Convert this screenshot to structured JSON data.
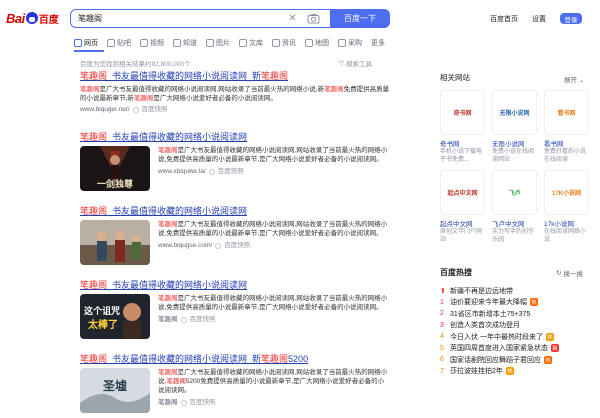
{
  "header": {
    "logo_text_a": "Bai",
    "logo_text_b": "百度",
    "query": "笔趣阁",
    "search_button": "百度一下",
    "nav": [
      "百度首页",
      "设置"
    ],
    "login": "登录"
  },
  "tabs": [
    "网页",
    "贴吧",
    "视频",
    "知道",
    "图片",
    "文库",
    "资讯",
    "地图",
    "采购",
    "更多"
  ],
  "result_count": "百度为您找到相关结果约92,800,000个",
  "search_tools": "搜索工具",
  "results": [
    {
      "title_parts": [
        {
          "t": "笔趣阁",
          "h": true
        },
        {
          "t": "_书友最值得收藏的网络小说阅读网_新",
          "h": false
        },
        {
          "t": "笔趣阁",
          "h": true
        }
      ],
      "desc_parts": [
        {
          "t": "笔趣阁",
          "h": true
        },
        {
          "t": "是广大书友最值得收藏的网络小说阅读网,网站收录了当前最火热的网络小说,新",
          "h": false
        },
        {
          "t": "笔趣阁",
          "h": true
        },
        {
          "t": "免费提供高质量的小说最新章节,新",
          "h": false
        },
        {
          "t": "笔趣阁",
          "h": true
        },
        {
          "t": "是广大网络小说爱好者必备的小说阅读网。",
          "h": false
        }
      ],
      "url": "www.biquger.net/",
      "snapshot": "百度快照"
    },
    {
      "title_parts": [
        {
          "t": "笔趣阁",
          "h": true
        },
        {
          "t": "_书友最值得收藏的网络小说阅读网",
          "h": false
        }
      ],
      "desc_parts": [
        {
          "t": "笔趣阁",
          "h": true
        },
        {
          "t": "是广大书友最值得收藏的网络小说阅读网,网站收录了当前最火热的网络小说,免费提供高质量的小说最新章节,是广大网络小说爱好者必备的小说阅读网。",
          "h": false
        }
      ],
      "url": "www.xbiquwx.la/",
      "snapshot": "百度快照",
      "thumb": "一剑独尊"
    },
    {
      "title_parts": [
        {
          "t": "笔趣阁",
          "h": true
        },
        {
          "t": "_书友最值得收藏的网络小说阅读网",
          "h": false
        }
      ],
      "desc_parts": [
        {
          "t": "笔趣阁",
          "h": true
        },
        {
          "t": "是广大书友最值得收藏的网络小说阅读网,网站收录了当前最火热的网络小说,免费提供高质量的小说最新章节,是广大网络小说爱好者必备的小说阅读网。",
          "h": false
        }
      ],
      "url": "www.biqugse.com/",
      "snapshot": "百度快照"
    },
    {
      "title_parts": [
        {
          "t": "笔趣阁",
          "h": true
        },
        {
          "t": "_书友最值得收藏的网络小说阅读网",
          "h": false
        }
      ],
      "desc_parts": [
        {
          "t": "笔趣阁",
          "h": true
        },
        {
          "t": "是广大书友最值得收藏的网络小说阅读网,网站收录了当前最火热的网络小说,免费提供高质量的小说最新章节,是广大网络小说爱好者必备的小说阅读网。",
          "h": false
        }
      ],
      "url": "笔趣阁",
      "snapshot": "百度快照",
      "thumb": "这个诅咒太棒了"
    },
    {
      "title_parts": [
        {
          "t": "笔趣阁",
          "h": true
        },
        {
          "t": "_书友最值得收藏的网络小说阅读网_新",
          "h": false
        },
        {
          "t": "笔趣阁",
          "h": true
        },
        {
          "t": "5200",
          "h": false
        }
      ],
      "desc_parts": [
        {
          "t": "笔趣阁",
          "h": true
        },
        {
          "t": "是广大书友最值得收藏的网络小说阅读网,网站收录了当前最火热的网络小说,",
          "h": false
        },
        {
          "t": "笔趣阁",
          "h": true
        },
        {
          "t": "5200免费提供高质量的小说最新章节,是广大网络小说爱好者必备的小说阅读网。",
          "h": false
        }
      ],
      "url": "笔趣阁",
      "snapshot": "百度快照"
    }
  ],
  "related": {
    "title": "相关网站",
    "expand": "展开",
    "sites": [
      {
        "name": "奇书网",
        "desc": "手机小说下载电子书免费...",
        "logo": "奇书网",
        "color": "#c0392b"
      },
      {
        "name": "无限小说网",
        "desc": "免费小说在线阅读网站",
        "logo": "无限小说网",
        "color": "#2b6cb0"
      },
      {
        "name": "看书网",
        "desc": "免费好看的小说在线阅读",
        "logo": "看书网",
        "color": "#e67e22"
      },
      {
        "name": "起点中文网",
        "desc": "原创文学门户网站",
        "logo": "起点中文网",
        "color": "#c0392b"
      },
      {
        "name": "飞卢中文网",
        "desc": "实力写手的创作乐园",
        "logo": "飞卢",
        "color": "#2eae4f"
      },
      {
        "name": "17k小说网",
        "desc": "在线阅读网络小说",
        "logo": "17K小说网",
        "color": "#e67e22"
      }
    ]
  },
  "hot": {
    "title": "百度热搜",
    "refresh": "换一换",
    "items": [
      {
        "n": "",
        "t": "新疆不再是边远地带",
        "badge": ""
      },
      {
        "n": "1",
        "t": "油价要迎来今年最大降幅",
        "badge": "热",
        "bc": "#ff6600"
      },
      {
        "n": "2",
        "t": "31省区市新增本土75+375",
        "badge": "",
        "bc": ""
      },
      {
        "n": "3",
        "t": "创造人类首次成功登月",
        "badge": "",
        "bc": ""
      },
      {
        "n": "4",
        "t": "今日入伏 一年中最热时段来了",
        "badge": "热",
        "bc": "#ff9900"
      },
      {
        "n": "5",
        "t": "英国四周首度进入国家紧急状态",
        "badge": "新",
        "bc": "#f73131"
      },
      {
        "n": "6",
        "t": "国家话剧院回应舞蹈子君回应",
        "badge": "热",
        "bc": "#ff6600"
      },
      {
        "n": "7",
        "t": "莎拉波娃挂拍2年",
        "badge": "热",
        "bc": "#ff9900"
      }
    ]
  }
}
